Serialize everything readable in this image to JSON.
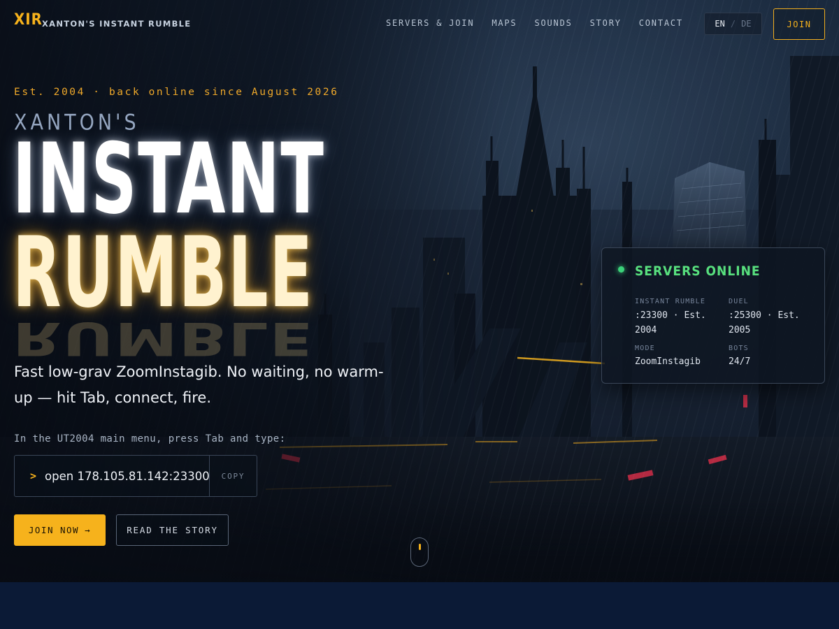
{
  "brand": {
    "mark": "XIR",
    "name": "XANTON'S INSTANT RUMBLE"
  },
  "nav": {
    "links": [
      "SERVERS & JOIN",
      "MAPS",
      "SOUNDS",
      "STORY",
      "CONTACT"
    ],
    "lang": {
      "active": "EN",
      "separator": "/",
      "inactive": "DE"
    },
    "join_label": "JOIN"
  },
  "hero": {
    "eyebrow": "Est. 2004 · back online since August 2026",
    "pre_title": "XANTON'S",
    "title_line1": "INSTANT",
    "title_line2": "RUMBLE",
    "tagline": "Fast low-grav ZoomInstagib. No waiting, no warm-up — hit Tab, connect, fire.",
    "instruction": "In the UT2004 main menu, press Tab and type:",
    "command": {
      "prompt": ">",
      "text": "open 178.105.81.142:23300",
      "copy_label": "COPY"
    },
    "join_button": {
      "label": "JOIN NOW",
      "arrow": "→"
    },
    "story_button": "READ THE STORY"
  },
  "servers_card": {
    "title": "SERVERS ONLINE",
    "status_color": "#3bd27a",
    "items": [
      {
        "label": "INSTANT RUMBLE",
        "value": ":23300 · Est. 2004"
      },
      {
        "label": "DUEL",
        "value": ":25300 · Est. 2005"
      },
      {
        "label": "MODE",
        "value": "ZoomInstagib"
      },
      {
        "label": "BOTS",
        "value": "24/7"
      }
    ]
  },
  "colors": {
    "accent": "#f6b21c",
    "online": "#3bd27a",
    "below_background": "#0b1a36"
  }
}
